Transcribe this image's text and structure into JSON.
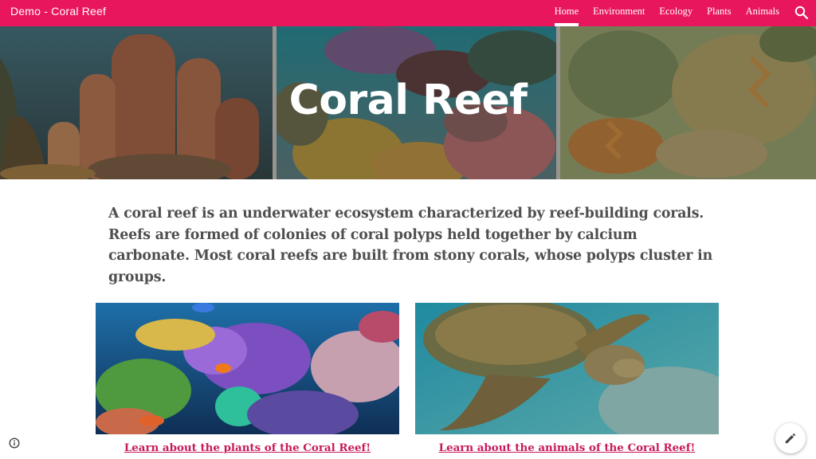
{
  "header": {
    "site_title": "Demo - Coral Reef",
    "nav": [
      {
        "label": "Home",
        "active": true
      },
      {
        "label": "Environment",
        "active": false
      },
      {
        "label": "Ecology",
        "active": false
      },
      {
        "label": "Plants",
        "active": false
      },
      {
        "label": "Animals",
        "active": false
      }
    ],
    "search_icon": "search-icon",
    "bar_color": "#e8175d"
  },
  "hero": {
    "title": "Coral Reef"
  },
  "intro": {
    "text": "A coral reef is an underwater ecosystem characterized by reef-building corals. Reefs are formed of colonies of coral polyps held together by calcium carbonate. Most coral reefs are built from stony corals, whose polyps cluster in groups."
  },
  "cards": [
    {
      "link_text": "Learn about the plants of the Coral Reef!"
    },
    {
      "link_text": "Learn about the animals of the Coral Reef!"
    }
  ],
  "controls": {
    "info_icon": "info-icon",
    "edit_icon": "pencil-icon"
  },
  "colors": {
    "accent": "#e8175d",
    "link": "#c71a5a",
    "body_text": "#4f4f4f"
  }
}
